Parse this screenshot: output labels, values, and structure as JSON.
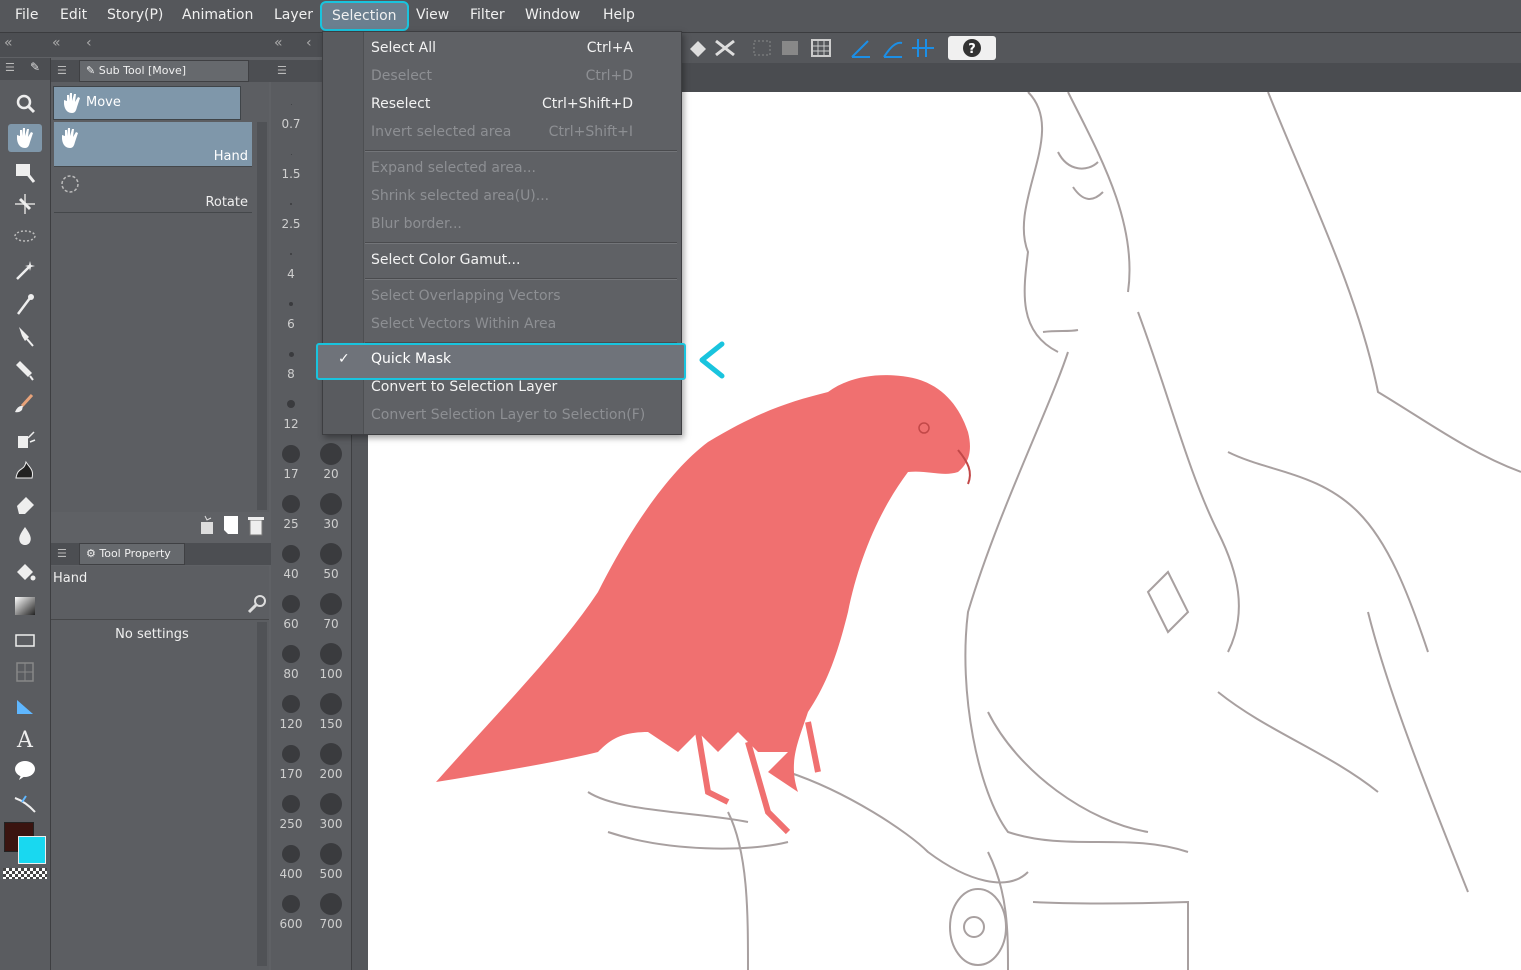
{
  "menubar": {
    "items": [
      "File",
      "Edit",
      "Story(P)",
      "Animation",
      "Layer",
      "Selection",
      "View",
      "Filter",
      "Window",
      "Help"
    ]
  },
  "subtool_panel": {
    "tab_label": "Sub Tool [Move]",
    "group_label": "Move",
    "items": [
      "Hand",
      "Rotate"
    ]
  },
  "tool_property": {
    "tab_label": "Tool Property",
    "tool_name": "Hand",
    "empty_text": "No settings"
  },
  "brush_sizes": [
    "0.7",
    "1.5",
    "2.5",
    "4",
    "6",
    "8",
    "12",
    "17",
    "20",
    "25",
    "30",
    "40",
    "50",
    "60",
    "70",
    "80",
    "100",
    "120",
    "150",
    "170",
    "200",
    "250",
    "300",
    "400",
    "500",
    "600",
    "700"
  ],
  "selection_menu": {
    "items": [
      {
        "label": "Select All",
        "shortcut": "Ctrl+A",
        "enabled": true
      },
      {
        "label": "Deselect",
        "shortcut": "Ctrl+D",
        "enabled": false
      },
      {
        "label": "Reselect",
        "shortcut": "Ctrl+Shift+D",
        "enabled": true
      },
      {
        "label": "Invert selected area",
        "shortcut": "Ctrl+Shift+I",
        "enabled": false
      },
      {
        "label": "Expand selected area...",
        "shortcut": "",
        "enabled": false
      },
      {
        "label": "Shrink selected area(U)...",
        "shortcut": "",
        "enabled": false
      },
      {
        "label": "Blur border...",
        "shortcut": "",
        "enabled": false
      },
      {
        "label": "Select Color Gamut...",
        "shortcut": "",
        "enabled": true
      },
      {
        "label": "Select Overlapping Vectors",
        "shortcut": "",
        "enabled": false
      },
      {
        "label": "Select Vectors Within Area",
        "shortcut": "",
        "enabled": false
      },
      {
        "label": "Quick Mask",
        "shortcut": "",
        "enabled": true,
        "checked": true
      },
      {
        "label": "Convert to Selection Layer",
        "shortcut": "",
        "enabled": true
      },
      {
        "label": "Convert Selection Layer to Selection(F)",
        "shortcut": "",
        "enabled": false
      }
    ],
    "checkmark": "✓"
  },
  "colors": {
    "accent_highlight": "#19c4de",
    "main_color": "#3a1410",
    "sub_color": "#19d8f0",
    "quick_mask_overlay": "#f07070"
  }
}
